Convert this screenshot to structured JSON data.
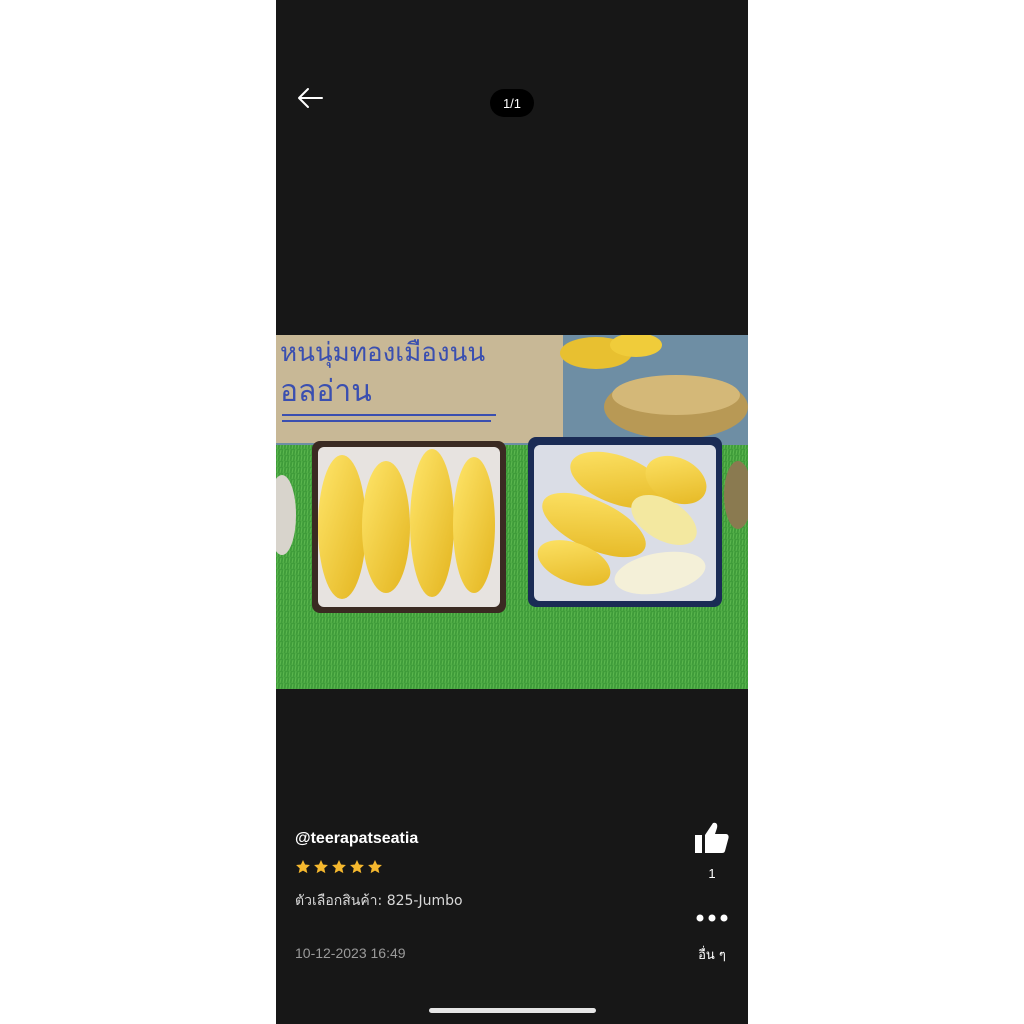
{
  "header": {
    "counter": "1/1"
  },
  "review": {
    "username": "@teerapatseatia",
    "rating": 5,
    "variation": "ตัวเลือกสินค้า: 825-Jumbo",
    "timestamp": "10-12-2023 16:49"
  },
  "actions": {
    "like_count": "1",
    "more_label": "อื่น ๆ"
  },
  "photo": {
    "sign_text_line1": "หนนุ่มทองเมืองนน",
    "sign_text_line2": "อลอ่าน"
  },
  "colors": {
    "background": "#171717",
    "star": "#f5b82e",
    "text": "#ffffff"
  },
  "icons": {
    "back": "arrow-left-icon",
    "like": "thumbs-up-icon",
    "more": "more-dots-icon",
    "star": "star-icon"
  }
}
